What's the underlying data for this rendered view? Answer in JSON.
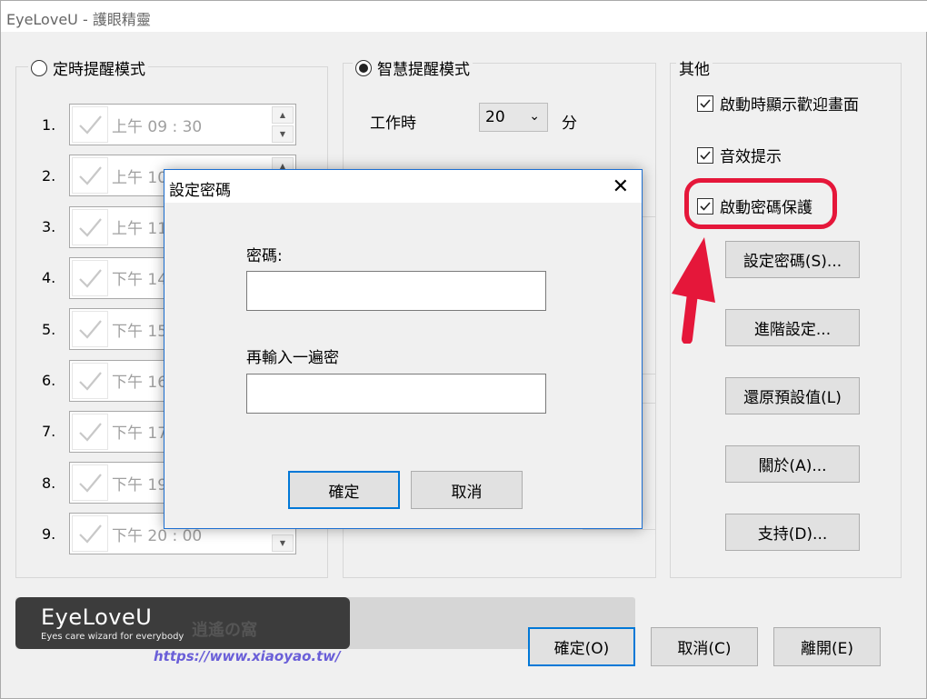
{
  "window": {
    "title": "EyeLoveU - 護眼精靈"
  },
  "timer_mode": {
    "label": "定時提醒模式",
    "rows": [
      {
        "num": "1.",
        "time": "上午 09 : 30",
        "spin": "updown"
      },
      {
        "num": "2.",
        "time": "上午 10",
        "spin": "updown"
      },
      {
        "num": "3.",
        "time": "上午 11",
        "spin": "none"
      },
      {
        "num": "4.",
        "time": "下午 14",
        "spin": "none"
      },
      {
        "num": "5.",
        "time": "下午 15",
        "spin": "none"
      },
      {
        "num": "6.",
        "time": "下午 16",
        "spin": "none"
      },
      {
        "num": "7.",
        "time": "下午 17",
        "spin": "none"
      },
      {
        "num": "8.",
        "time": "下午 19",
        "spin": "none"
      },
      {
        "num": "9.",
        "time": "下午 20 : 00",
        "spin": "down"
      }
    ]
  },
  "smart_mode": {
    "label": "智慧提醒模式",
    "work_label": "工作時",
    "work_value": "20",
    "work_unit": "分"
  },
  "other": {
    "label": "其他",
    "options": [
      {
        "label": "啟動時顯示歡迎畫面",
        "checked": true
      },
      {
        "label": "音效提示",
        "checked": true
      },
      {
        "label": "啟動密碼保護",
        "checked": true
      }
    ],
    "buttons": [
      "設定密碼(S)...",
      "進階設定...",
      "還原預設值(L)",
      "關於(A)...",
      "支持(D)..."
    ]
  },
  "footer": {
    "brand": "EyeLoveU",
    "tagline": "Eyes care wizard for everybody",
    "watermark_name": "逍遙の窩",
    "watermark_url": "https://www.xiaoyao.tw/",
    "ok": "確定(O)",
    "cancel": "取消(C)",
    "exit": "離開(E)"
  },
  "dialog": {
    "title": "設定密碼",
    "password_label": "密碼:",
    "confirm_label": "再輸入一遍密",
    "ok": "確定",
    "cancel": "取消"
  },
  "colors": {
    "highlight": "#e5173a",
    "accent": "#0078d7"
  }
}
